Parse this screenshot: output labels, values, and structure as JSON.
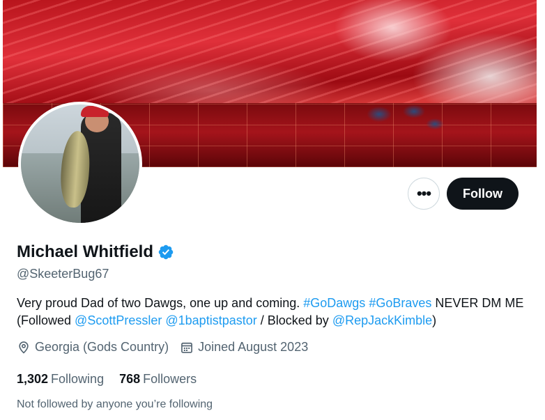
{
  "profile": {
    "display_name": "Michael Whitfield",
    "handle": "@SkeeterBug67",
    "verified": true,
    "bio": {
      "text_1": "Very proud Dad of two Dawgs, one up and coming.",
      "hashtag_1": "#GoDawgs",
      "hashtag_2": "#GoBraves",
      "text_2": "NEVER DM ME (Followed",
      "mention_1": "@ScottPressler",
      "mention_2": "@1baptistpastor",
      "text_3": "/ Blocked by",
      "mention_3": "@RepJackKimble",
      "text_4": ")"
    },
    "location": "Georgia (Gods Country)",
    "joined": "Joined August 2023",
    "following_count": "1,302",
    "following_label": "Following",
    "followers_count": "768",
    "followers_label": "Followers",
    "not_followed_text": "Not followed by anyone you’re following"
  },
  "actions": {
    "more_label": "•••",
    "follow_label": "Follow"
  },
  "colors": {
    "accent": "#1d9bf0",
    "text_primary": "#0f1419",
    "text_secondary": "#536471",
    "follow_bg": "#0f1419"
  },
  "icons": {
    "verified": "verified-badge-icon",
    "location": "location-pin-icon",
    "calendar": "calendar-icon",
    "more": "more-dots-icon"
  }
}
